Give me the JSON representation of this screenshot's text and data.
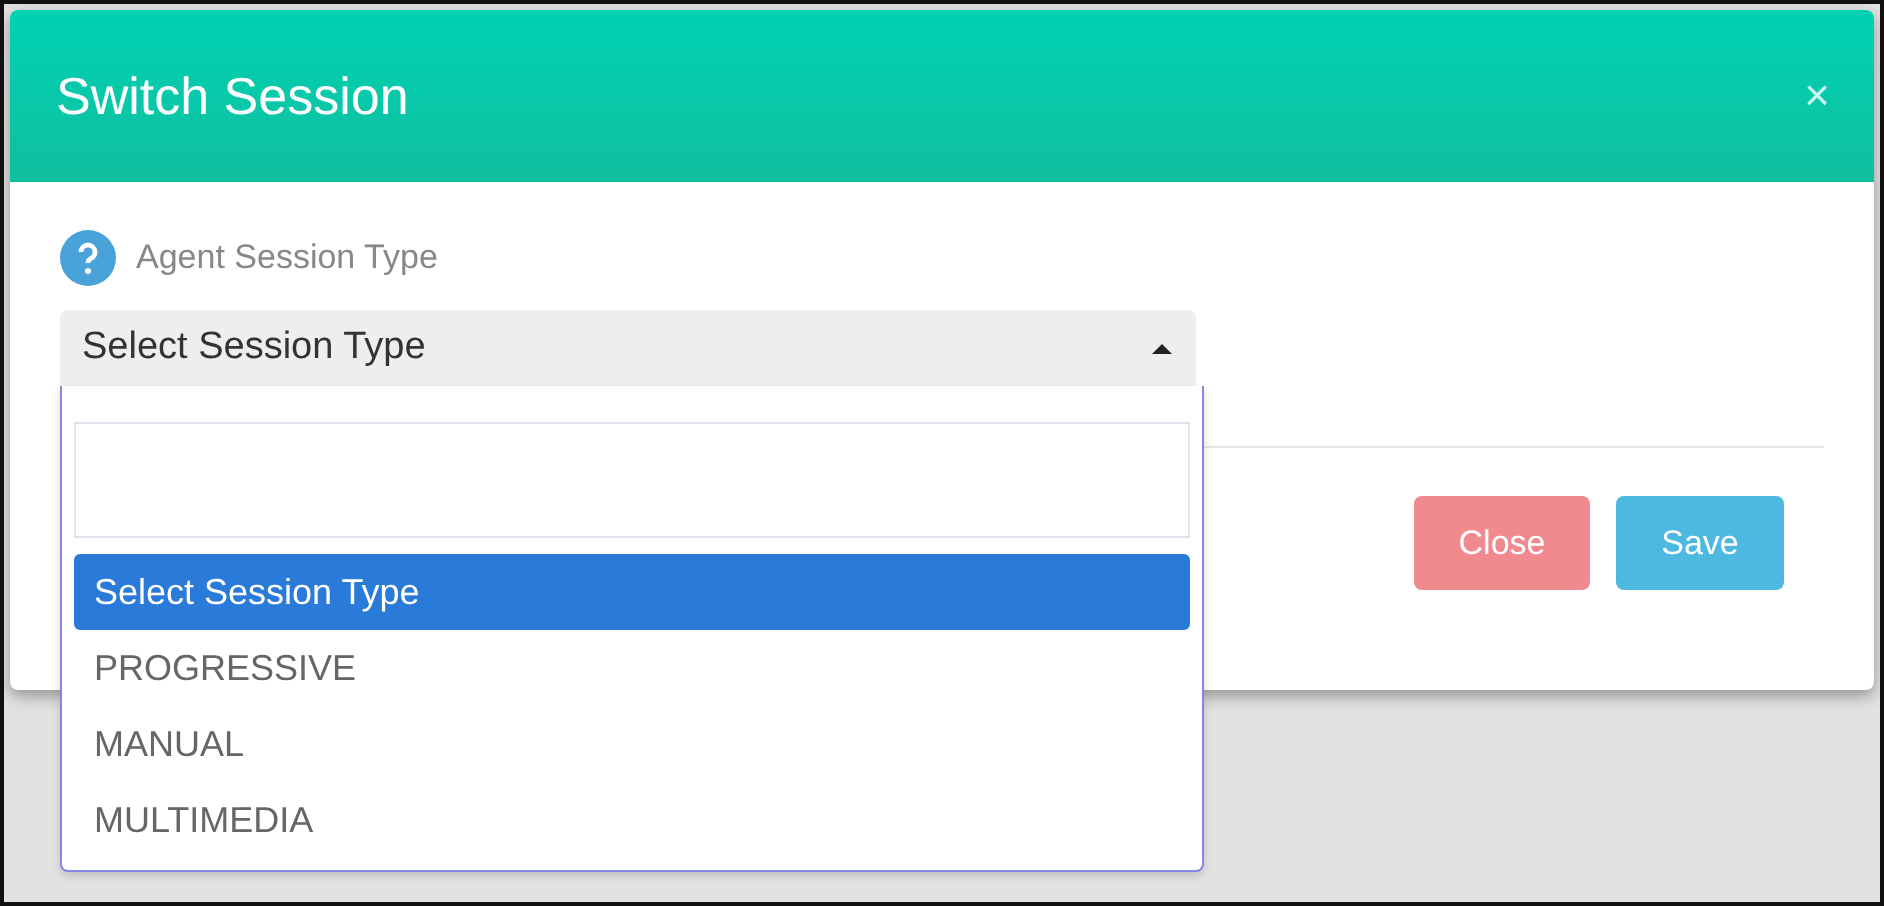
{
  "dialog": {
    "title": "Switch Session",
    "close_glyph": "×"
  },
  "field": {
    "label": "Agent Session Type",
    "value": "Select Session Type",
    "expanded": true
  },
  "dropdown": {
    "options": [
      {
        "label": "Select Session Type",
        "selected": true
      },
      {
        "label": "PROGRESSIVE",
        "selected": false
      },
      {
        "label": "MANUAL",
        "selected": false
      },
      {
        "label": "MULTIMEDIA",
        "selected": false
      }
    ]
  },
  "buttons": [
    {
      "label": "Close",
      "kind": "close"
    },
    {
      "label": "Save",
      "kind": "save"
    }
  ]
}
